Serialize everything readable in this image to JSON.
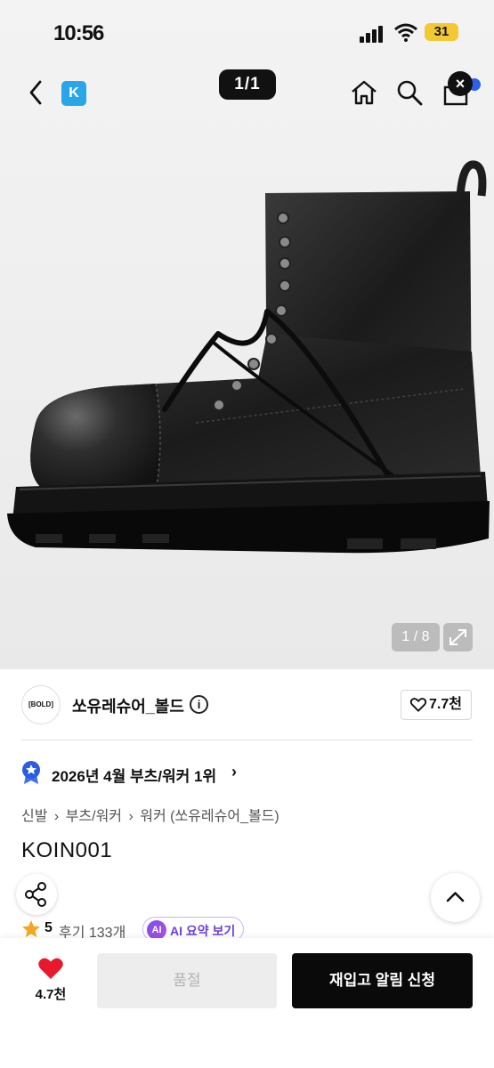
{
  "status_bar": {
    "time": "10:56",
    "battery": "31"
  },
  "header": {
    "image_pager": "1/1",
    "brand_badge": "K",
    "close_badge": "×"
  },
  "gallery": {
    "counter": "1 / 8"
  },
  "brand": {
    "logo_text": "[BOLD]",
    "name": "쏘유레슈어_볼드",
    "info_glyph": "i",
    "likes": "7.7천"
  },
  "ranking": {
    "text": "2026년 4월 부츠/워커 1위",
    "arrow": "›"
  },
  "breadcrumb": {
    "items": [
      "신발",
      "›",
      "부츠/워커",
      "›",
      "워커 (쏘유레슈어_볼드)"
    ]
  },
  "product": {
    "title": "KOIN001",
    "rating": "5",
    "reviews": "후기 133개",
    "ai_badge": "AI",
    "ai_label": "AI 요약 보기"
  },
  "bottom_bar": {
    "wish_count": "4.7천",
    "soldout_label": "품절",
    "restock_label": "재입고 알림 신청"
  },
  "colors": {
    "accent_blue": "#2aa6e8",
    "heart_red": "#e8192c",
    "ai_purple": "#6c3fd8",
    "star_orange": "#f5a623",
    "button_black": "#0a0a0a"
  }
}
